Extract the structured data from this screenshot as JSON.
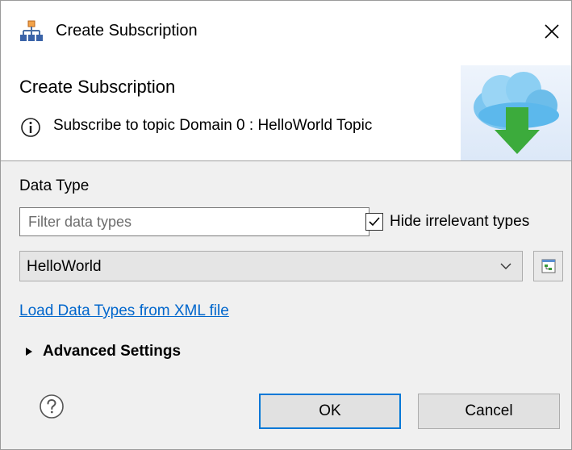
{
  "window": {
    "title": "Create Subscription",
    "icon": "subscription-app-icon",
    "close_icon": "close-icon"
  },
  "banner": {
    "title": "Create Subscription",
    "message": "Subscribe to topic Domain 0 : HelloWorld Topic",
    "info_icon": "info-icon",
    "graphic": "cloud-download-icon",
    "colors": {
      "cloud": "#5cb8ec",
      "arrow": "#3cab3c"
    }
  },
  "data_type": {
    "label": "Data Type",
    "filter": {
      "value": "",
      "placeholder": "Filter data types"
    },
    "hide_irrelevant": {
      "label": "Hide irrelevant types",
      "checked": true
    },
    "selected_type": "HelloWorld",
    "browse_icon": "type-tree-icon"
  },
  "load_link": "Load Data Types from XML file",
  "advanced": {
    "label": "Advanced Settings",
    "expanded": false
  },
  "footer": {
    "help_icon": "help-icon",
    "ok_label": "OK",
    "cancel_label": "Cancel"
  },
  "colors": {
    "link": "#0066cc",
    "focus": "#0078d7"
  }
}
